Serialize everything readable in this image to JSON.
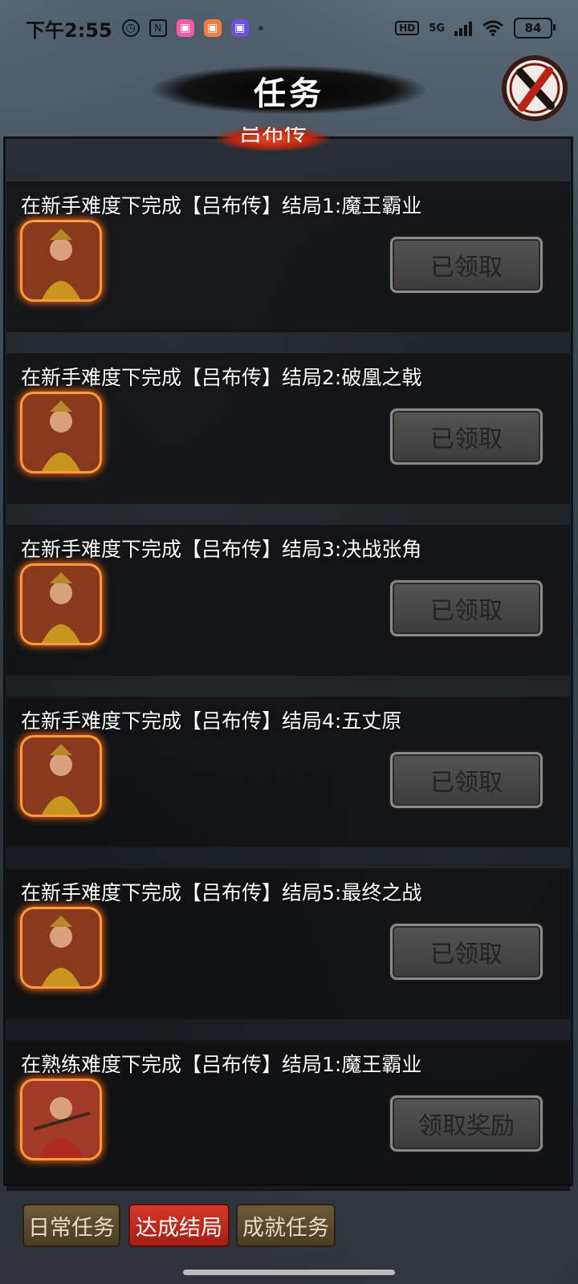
{
  "status_bar": {
    "time": "下午2:55",
    "hd": "HD",
    "network": "5G",
    "battery": "84"
  },
  "header": {
    "title": "任务",
    "section_tag": "吕布传"
  },
  "tasks": [
    {
      "text": "在新手难度下完成【吕布传】结局1:魔王霸业",
      "button": "已领取"
    },
    {
      "text": "在新手难度下完成【吕布传】结局2:破凰之戟",
      "button": "已领取"
    },
    {
      "text": "在新手难度下完成【吕布传】结局3:决战张角",
      "button": "已领取"
    },
    {
      "text": "在新手难度下完成【吕布传】结局4:五丈原",
      "button": "已领取"
    },
    {
      "text": "在新手难度下完成【吕布传】结局5:最终之战",
      "button": "已领取"
    },
    {
      "text": "在熟练难度下完成【吕布传】结局1:魔王霸业",
      "button": "领取奖励"
    }
  ],
  "tabs": [
    {
      "label": "日常任务"
    },
    {
      "label": "达成结局"
    },
    {
      "label": "成就任务"
    }
  ],
  "colors": {
    "active_tab": "#c42d1f",
    "inactive_tab": "#5a4a30",
    "avatar_glow": "#ff7a20"
  }
}
